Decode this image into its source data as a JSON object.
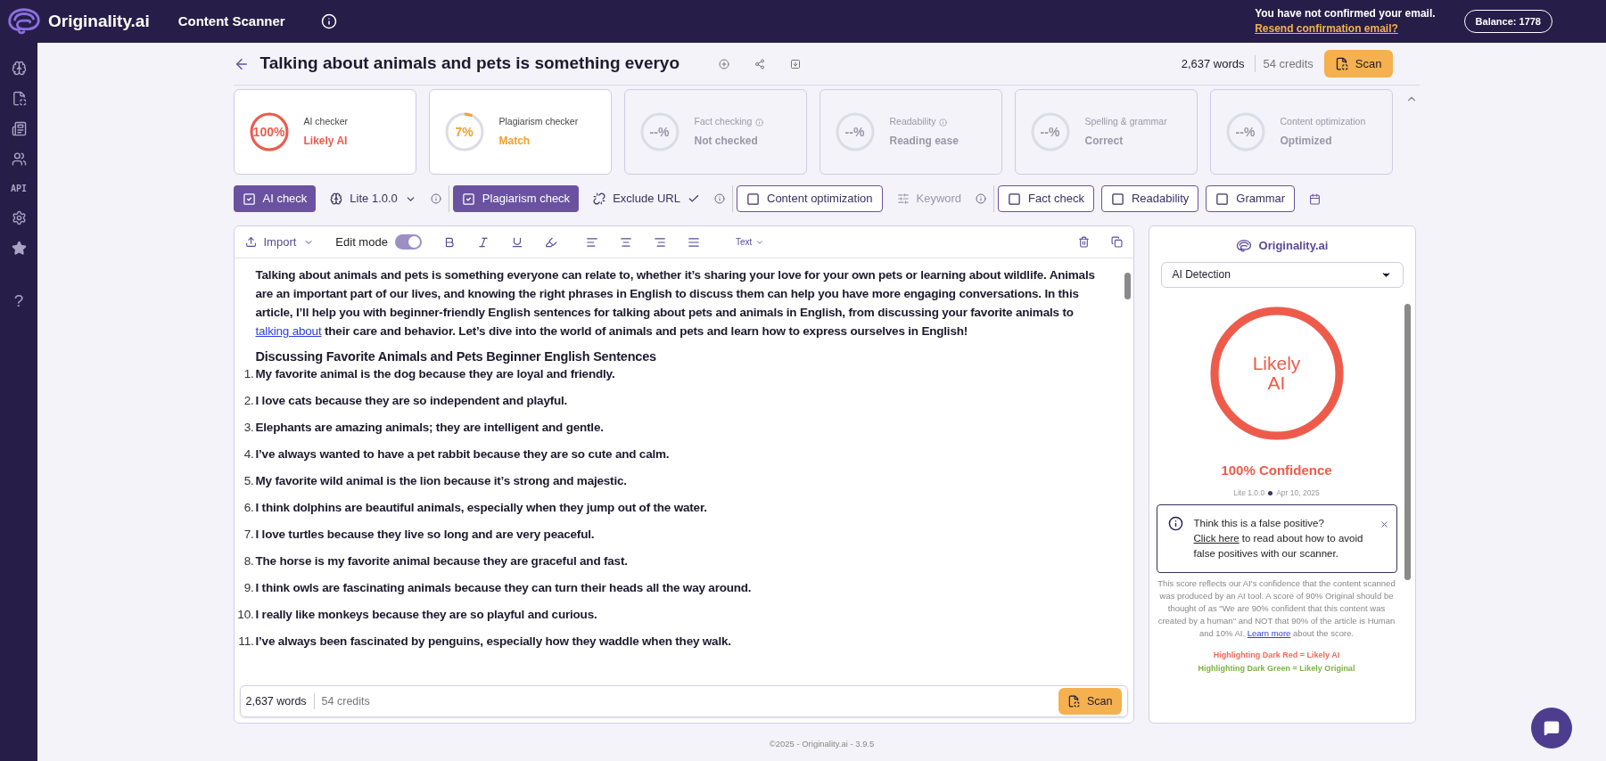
{
  "topbar": {
    "brand": "Originality.ai",
    "app_title": "Content Scanner",
    "notice": "You have not confirmed your email.",
    "notice_link": "Resend confirmation email?",
    "balance": "Balance: 1778"
  },
  "sidebar": {
    "api_label": "API",
    "help_label": "?"
  },
  "document": {
    "title": "Talking about animals and pets is something everyo",
    "words": "2,637 words",
    "credits": "54 credits",
    "scan": "Scan"
  },
  "cards": [
    {
      "title": "AI checker",
      "status": "Likely AI",
      "value": "100%",
      "level": 1,
      "color": "#ef5b4b",
      "disabled": false
    },
    {
      "title": "Plagiarism checker",
      "status": "Match",
      "value": "7%",
      "level": 0.07,
      "color": "#f0a030",
      "disabled": false
    },
    {
      "title": "Fact checking",
      "status": "Not checked",
      "value": "--%",
      "info": true,
      "disabled": true
    },
    {
      "title": "Readability",
      "status": "Reading ease",
      "value": "--%",
      "info": true,
      "disabled": true
    },
    {
      "title": "Spelling & grammar",
      "status": "Correct",
      "value": "--%",
      "disabled": true
    },
    {
      "title": "Content optimization",
      "status": "Optimized",
      "value": "--%",
      "disabled": true
    }
  ],
  "options": [
    [
      {
        "kind": "check",
        "label": "AI check",
        "checked": true
      },
      {
        "kind": "select",
        "label": "Lite 1.0.0",
        "info": true
      }
    ],
    [
      {
        "kind": "check",
        "label": "Plagiarism check",
        "checked": true
      },
      {
        "kind": "toggle",
        "label": "Exclude URL",
        "checked": true,
        "info": true
      }
    ],
    [
      {
        "kind": "check",
        "label": "Content optimization",
        "checked": false
      },
      {
        "kind": "input",
        "label": "Keyword",
        "disabled": true,
        "info": true
      }
    ],
    [
      {
        "kind": "check",
        "label": "Fact check",
        "checked": false
      },
      {
        "kind": "check",
        "label": "Readability",
        "checked": false
      },
      {
        "kind": "check",
        "label": "Grammar",
        "checked": false
      }
    ]
  ],
  "editor": {
    "import": "Import",
    "edit_mode": "Edit mode",
    "edit_mode_on": true,
    "text_style": "Text",
    "intro_before": "Talking about animals and pets is something everyone can relate to, whether it’s sharing your love for your own pets or learning about wildlife. Animals are an important part of our lives, and knowing the right phrases in English to discuss them can help you have more engaging conversations. In this article, I’ll help you with beginner-friendly English sentences for talking about pets and animals in English, from discussing your favorite animals to ",
    "intro_link": "talking about",
    "intro_after": " their care and behavior. Let’s dive into the world of animals and pets and learn how to express ourselves in English!",
    "heading": "Discussing Favorite Animals and Pets Beginner English Sentences",
    "items": [
      {
        "number": "1.",
        "text": "My favorite animal is the dog because they are loyal and friendly."
      },
      {
        "number": "2.",
        "text": "I love cats because they are so independent and playful."
      },
      {
        "number": "3.",
        "text": "Elephants are amazing animals; they are intelligent and gentle."
      },
      {
        "number": "4.",
        "text": "I’ve always wanted to have a pet rabbit because they are so cute and calm."
      },
      {
        "number": "5.",
        "text": "My favorite wild animal is the lion because it’s strong and majestic."
      },
      {
        "number": "6.",
        "text": "I think dolphins are beautiful animals, especially when they jump out of the water."
      },
      {
        "number": "7.",
        "text": "I love turtles because they live so long and are very peaceful."
      },
      {
        "number": "8.",
        "text": "The horse is my favorite animal because they are graceful and fast."
      },
      {
        "number": "9.",
        "text": "I think owls are fascinating animals because they can turn their heads all the way around."
      },
      {
        "number": "10.",
        "text": "I really like monkeys because they are so playful and curious."
      },
      {
        "number": "11.",
        "text": "I’ve always been fascinated by penguins, especially how they waddle when they walk."
      }
    ],
    "words": "2,637 words",
    "credits": "54 credits",
    "scan": "Scan"
  },
  "panel": {
    "brand": "Originality.ai",
    "mode": "AI Detection",
    "ring_label": "Likely AI",
    "level": 1,
    "color": "#ef5b4b",
    "confidence": "100% Confidence",
    "model": "Lite 1.0.0",
    "date": "Apr 10, 2025",
    "alert_title": "Think this is a false positive?",
    "alert_link": "Click here",
    "alert_text": " to read about how to avoid false positives with our scanner.",
    "explanation": "This score reflects our AI's confidence that the content scanned was produced by an AI tool. A score of 90% Original should be thought of as \"We are 90% confident that this content was created by a human\" and NOT that 90% of the article is Human and 10% AI. ",
    "explanation_link": "Learn more",
    "explanation_after": " about the score.",
    "legend": [
      {
        "text": "Highlighting Dark Red = Likely AI",
        "color": "#ef6b5b"
      },
      {
        "text": "Highlighting Dark Green = Likely Original",
        "color": "#7cb342"
      }
    ]
  },
  "footer": "©2025 - Originality.ai - 3.9.5"
}
